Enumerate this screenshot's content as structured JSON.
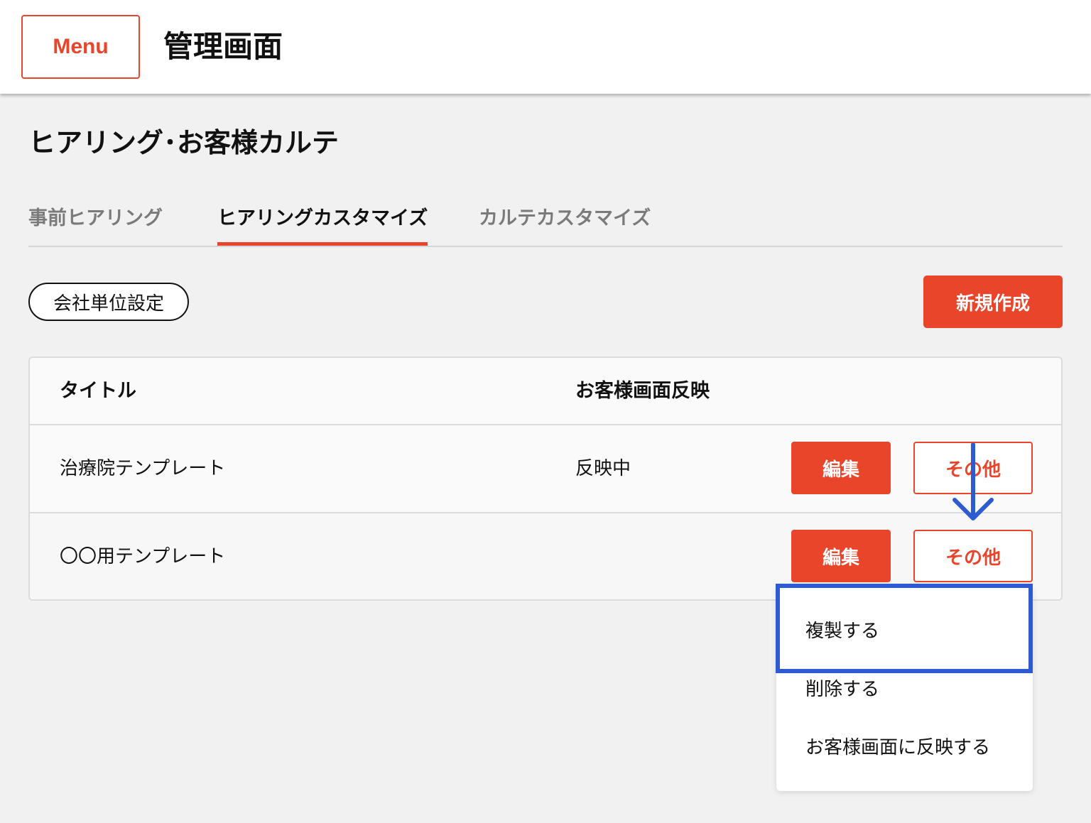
{
  "header": {
    "menu_label": "Menu",
    "app_title": "管理画面"
  },
  "page": {
    "title": "ヒアリング･お客様カルテ"
  },
  "tabs": [
    {
      "label": "事前ヒアリング",
      "active": false
    },
    {
      "label": "ヒアリングカスタマイズ",
      "active": true
    },
    {
      "label": "カルテカスタマイズ",
      "active": false
    }
  ],
  "toolbar": {
    "company_setting_label": "会社単位設定",
    "new_label": "新規作成"
  },
  "table": {
    "columns": [
      "タイトル",
      "お客様画面反映"
    ],
    "rows": [
      {
        "title": "治療院テンプレート",
        "reflect": "反映中",
        "edit_label": "編集",
        "other_label": "その他"
      },
      {
        "title": "〇〇用テンプレート",
        "reflect": "",
        "edit_label": "編集",
        "other_label": "その他"
      }
    ]
  },
  "dropdown": {
    "items": [
      "複製する",
      "削除する",
      "お客様画面に反映する"
    ]
  },
  "annotations": {
    "highlight_color": "#2e5bd1",
    "arrow_color": "#2e5bd1"
  },
  "colors": {
    "accent": "#e8452b",
    "background": "#f1f1f1"
  }
}
